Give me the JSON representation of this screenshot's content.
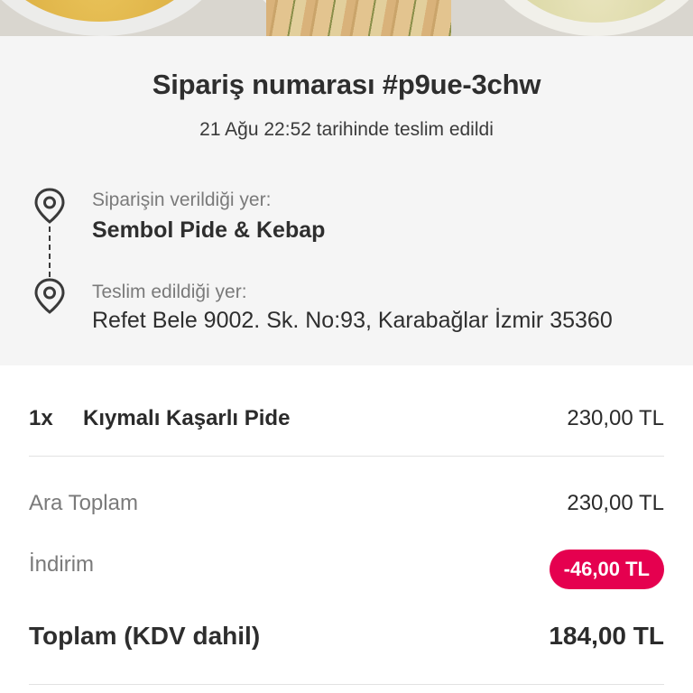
{
  "header": {
    "title": "Sipariş numarası #p9ue-3chw",
    "delivered_text": "21 Ağu 22:52 tarihinde teslim edildi"
  },
  "route": {
    "from_label": "Siparişin verildiği yer:",
    "from_value": "Sembol Pide & Kebap",
    "to_label": "Teslim edildiği yer:",
    "to_value": "Refet Bele 9002. Sk. No:93, Karabağlar İzmir 35360",
    "icons": [
      "location-pin-icon",
      "location-pin-icon"
    ]
  },
  "items": [
    {
      "qty": "1x",
      "name": "Kıymalı Kaşarlı Pide",
      "price": "230,00 TL"
    }
  ],
  "summary": {
    "subtotal_label": "Ara Toplam",
    "subtotal_value": "230,00 TL",
    "discount_label": "İndirim",
    "discount_value": "-46,00 TL",
    "total_label": "Toplam (KDV dahil)",
    "total_value": "184,00 TL"
  },
  "colors": {
    "accent": "#e5004f",
    "panel_background": "#f5f5f5"
  }
}
